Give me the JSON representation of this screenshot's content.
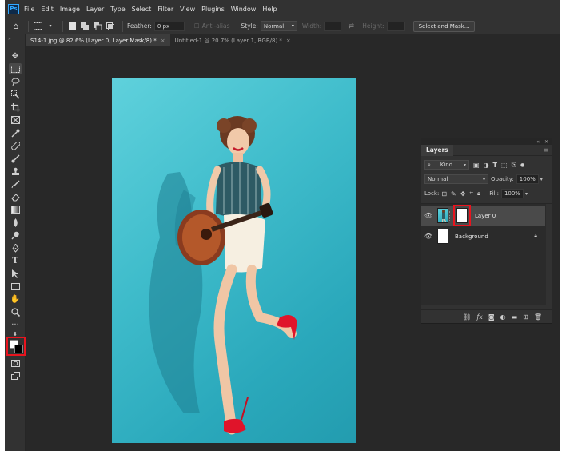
{
  "menubar": {
    "logo": "Ps",
    "items": [
      "File",
      "Edit",
      "Image",
      "Layer",
      "Type",
      "Select",
      "Filter",
      "View",
      "Plugins",
      "Window",
      "Help"
    ]
  },
  "options": {
    "feather_label": "Feather:",
    "feather_value": "0 px",
    "antialias_label": "Anti-alias",
    "style_label": "Style:",
    "style_value": "Normal",
    "width_label": "Width:",
    "height_label": "Height:",
    "select_mask_label": "Select and Mask..."
  },
  "tabs": [
    {
      "label": "S14-1.jpg @ 82.6% (Layer 0, Layer Mask/8) *",
      "close": "×",
      "active": true
    },
    {
      "label": "Untitled-1 @ 20.7% (Layer 1, RGB/8) *",
      "close": "×",
      "active": false
    }
  ],
  "toolbar": {
    "collapse": "»",
    "icons": [
      "move-icon",
      "marquee-icon",
      "lasso-icon",
      "object-select-icon",
      "crop-icon",
      "frame-icon",
      "eyedropper-icon",
      "healing-brush-icon",
      "brush-icon",
      "clone-stamp-icon",
      "history-brush-icon",
      "eraser-icon",
      "gradient-icon",
      "blur-icon",
      "dodge-icon",
      "pen-icon",
      "type-icon",
      "path-select-icon",
      "rectangle-icon",
      "hand-icon",
      "zoom-icon",
      "more-tools-icon",
      "quick-mask-icon",
      "screen-mode-icon"
    ],
    "foreground_color": "#ffffff",
    "background_color": "#000000"
  },
  "layers_panel": {
    "tab_label": "Layers",
    "filter_kind": "Kind",
    "blend_mode": "Normal",
    "opacity_label": "Opacity:",
    "opacity_value": "100%",
    "lock_label": "Lock:",
    "fill_label": "Fill:",
    "fill_value": "100%",
    "layers": [
      {
        "name": "Layer 0",
        "selected": true,
        "has_mask": true
      },
      {
        "name": "Background",
        "selected": false,
        "locked": true
      }
    ]
  },
  "colors": {
    "highlight": "#e8141e",
    "canvas_bg": "#3fbccb",
    "ui_dark": "#282828"
  }
}
